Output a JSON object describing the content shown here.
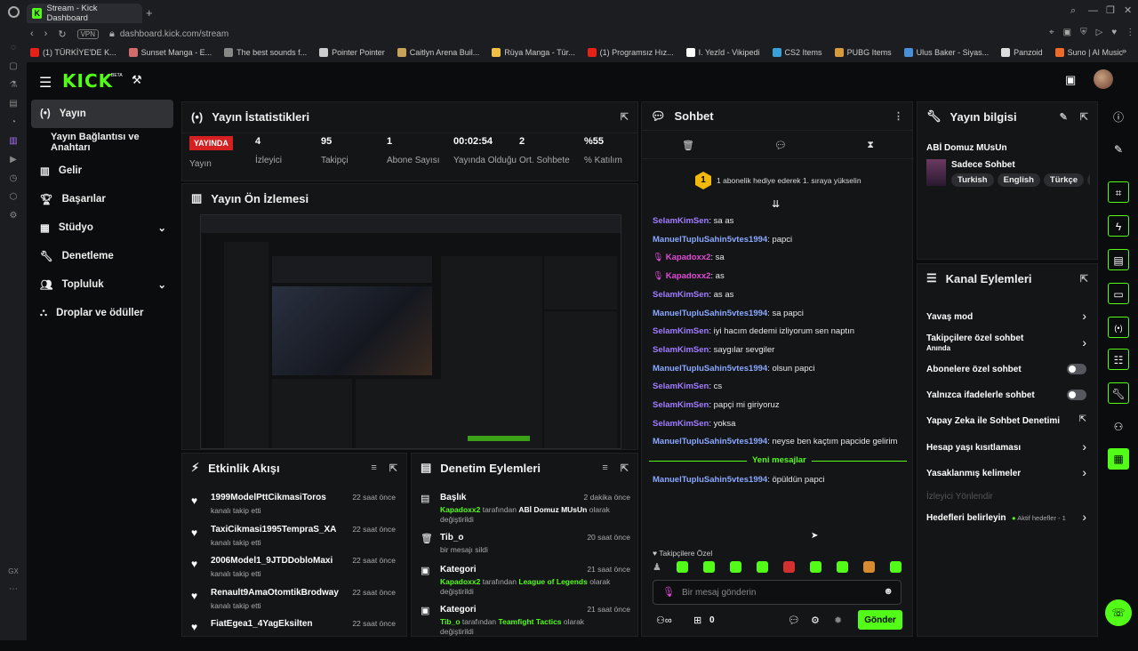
{
  "browser": {
    "tab_title": "Stream - Kick Dashboard",
    "vpn": "VPN",
    "url": "dashboard.kick.com/stream",
    "bookmarks": [
      {
        "label": "(1) TÜRKİYE'DE K...",
        "color": "#e62117"
      },
      {
        "label": "Sunset Manga - E...",
        "color": "#d46b6b"
      },
      {
        "label": "The best sounds f...",
        "color": "#888888"
      },
      {
        "label": "Pointer Pointer",
        "color": "#cccccc"
      },
      {
        "label": "Caitlyn Arena Buil...",
        "color": "#c7a35a"
      },
      {
        "label": "Rüya Manga - Tür...",
        "color": "#f0c040"
      },
      {
        "label": "(1) Programsız Hız...",
        "color": "#e62117"
      },
      {
        "label": "I. Yezîd - Vikipedi",
        "color": "#ffffff"
      },
      {
        "label": "CS2 Items",
        "color": "#3aa0d8"
      },
      {
        "label": "PUBG Items",
        "color": "#d89a3a"
      },
      {
        "label": "Ulus Baker - Siyas...",
        "color": "#4a90d9"
      },
      {
        "label": "Panzoid",
        "color": "#dddddd"
      },
      {
        "label": "Suno | AI Music",
        "color": "#f06a2a"
      }
    ]
  },
  "brand": {
    "logo": "KICK",
    "beta": "BETA",
    "accent": "#53fc18"
  },
  "sidebar": {
    "items": [
      {
        "label": "Yayın"
      },
      {
        "label": "Yayın Bağlantısı ve Anahtarı"
      },
      {
        "label": "Gelir"
      },
      {
        "label": "Başarılar"
      },
      {
        "label": "Stüdyo"
      },
      {
        "label": "Denetleme"
      },
      {
        "label": "Topluluk"
      },
      {
        "label": "Droplar ve ödüller"
      }
    ]
  },
  "stats": {
    "title": "Yayın İstatistikleri",
    "live_badge": "YAYINDA",
    "live_label": "Yayın",
    "items": [
      {
        "value": "4",
        "label": "İzleyici"
      },
      {
        "value": "95",
        "label": "Takipçi"
      },
      {
        "value": "1",
        "label": "Abone Sayısı"
      },
      {
        "value": "00:02:54",
        "label": "Yayında Olduğu"
      },
      {
        "value": "2",
        "label": "Ort. Sohbete"
      },
      {
        "value": "%55",
        "label": "% Katılım"
      }
    ]
  },
  "preview": {
    "title": "Yayın Ön İzlemesi"
  },
  "chat": {
    "title": "Sohbet",
    "promo": "1 abonelik hediye ederek 1. sıraya yükselin",
    "promo_badge": "1",
    "messages": [
      {
        "user": "SelamKimSen",
        "text": ": sa as",
        "cls": "u1"
      },
      {
        "user": "ManuelTupluSahin5vtes1994",
        "text": ": papci",
        "cls": "u2"
      },
      {
        "user": "Kapadoxx2",
        "text": ": sa",
        "cls": "u3"
      },
      {
        "user": "Kapadoxx2",
        "text": ": as",
        "cls": "u3"
      },
      {
        "user": "SelamKimSen",
        "text": ": as as",
        "cls": "u1"
      },
      {
        "user": "ManuelTupluSahin5vtes1994",
        "text": ": sa papci",
        "cls": "u2"
      },
      {
        "user": "SelamKimSen",
        "text": ": iyi hacım dedemi izliyorum sen naptın",
        "cls": "u1"
      },
      {
        "user": "SelamKimSen",
        "text": ": saygılar sevgiler",
        "cls": "u1"
      },
      {
        "user": "ManuelTupluSahin5vtes1994",
        "text": ": olsun papci",
        "cls": "u2"
      },
      {
        "user": "SelamKimSen",
        "text": ": cs",
        "cls": "u1"
      },
      {
        "user": "SelamKimSen",
        "text": ": papçi mi giriyoruz",
        "cls": "u1"
      },
      {
        "user": "SelamKimSen",
        "text": ": yoksa",
        "cls": "u1"
      },
      {
        "user": "ManuelTupluSahin5vtes1994",
        "text": ": neyse ben kaçtım papcide gelirim",
        "cls": "u2"
      }
    ],
    "new_divider": "Yeni mesajlar",
    "new_message": {
      "user": "ManuelTupluSahin5vtes1994",
      "text": ": öpüldün papci"
    },
    "followers_only": "Takipçilere Özel",
    "input_placeholder": "Bir mesaj gönderin",
    "count": "0",
    "send_label": "Gönder"
  },
  "stream_info": {
    "title": "Yayın bilgisi",
    "stream_title": "ABİ Domuz MUsUn",
    "category": "Sadece Sohbet",
    "tags": [
      "Turkish",
      "English",
      "Türkçe",
      "ci"
    ]
  },
  "channel_actions": {
    "title": "Kanal Eylemleri",
    "items": [
      {
        "label": "Yavaş mod",
        "kind": "chevron"
      },
      {
        "label": "Takipçilere özel sohbet",
        "sub": "Anında",
        "kind": "chevron"
      },
      {
        "label": "Abonelere özel sohbet",
        "kind": "toggle"
      },
      {
        "label": "Yalnızca ifadelerle sohbet",
        "kind": "toggle"
      },
      {
        "label": "Yapay Zeka ile Sohbet Denetimi",
        "kind": "external"
      },
      {
        "label": "Hesap yaşı kısıtlaması",
        "kind": "chevron"
      },
      {
        "label": "Yasaklanmış kelimeler",
        "kind": "chevron"
      }
    ],
    "viewer_redirect": "İzleyici Yönlendir",
    "goals_label": "Hedefleri belirleyin",
    "goals_status": "Aktif hedefler - 1"
  },
  "activity": {
    "title": "Etkinlik Akışı",
    "items": [
      {
        "name": "1999ModelPttCikmasiToros",
        "sub": "kanalı takip etti",
        "time": "22 saat önce"
      },
      {
        "name": "TaxiCikmasi1995TempraS_XA",
        "sub": "kanalı takip etti",
        "time": "22 saat önce"
      },
      {
        "name": "2006Model1_9JTDDobloMaxi",
        "sub": "kanalı takip etti",
        "time": "22 saat önce"
      },
      {
        "name": "Renault9AmaOtomtikBrodway",
        "sub": "kanalı takip etti",
        "time": "22 saat önce"
      },
      {
        "name": "FiatEgea1_4YagEksilten",
        "sub": "",
        "time": "22 saat önce"
      }
    ]
  },
  "moderation": {
    "title": "Denetim Eylemleri",
    "items": [
      {
        "name": "Başlık",
        "time": "2 dakika önce",
        "actor": "Kapadoxx2",
        "mid": " tarafından ",
        "target": "ABİ Domuz MUsUn",
        "tail": " olarak değiştirildi",
        "target_green": false
      },
      {
        "name": "Tib_o",
        "time": "20 saat önce",
        "actor": "",
        "mid": "bir mesajı sildi",
        "target": "",
        "tail": "",
        "target_green": false
      },
      {
        "name": "Kategori",
        "time": "21 saat önce",
        "actor": "Kapadoxx2",
        "mid": " tarafından ",
        "target": "League of Legends",
        "tail": " olarak değiştirildi",
        "target_green": true
      },
      {
        "name": "Kategori",
        "time": "21 saat önce",
        "actor": "Tib_o",
        "mid": " tarafından ",
        "target": "Teamfight Tactics",
        "tail": " olarak değiştirildi",
        "target_green": true
      }
    ]
  }
}
